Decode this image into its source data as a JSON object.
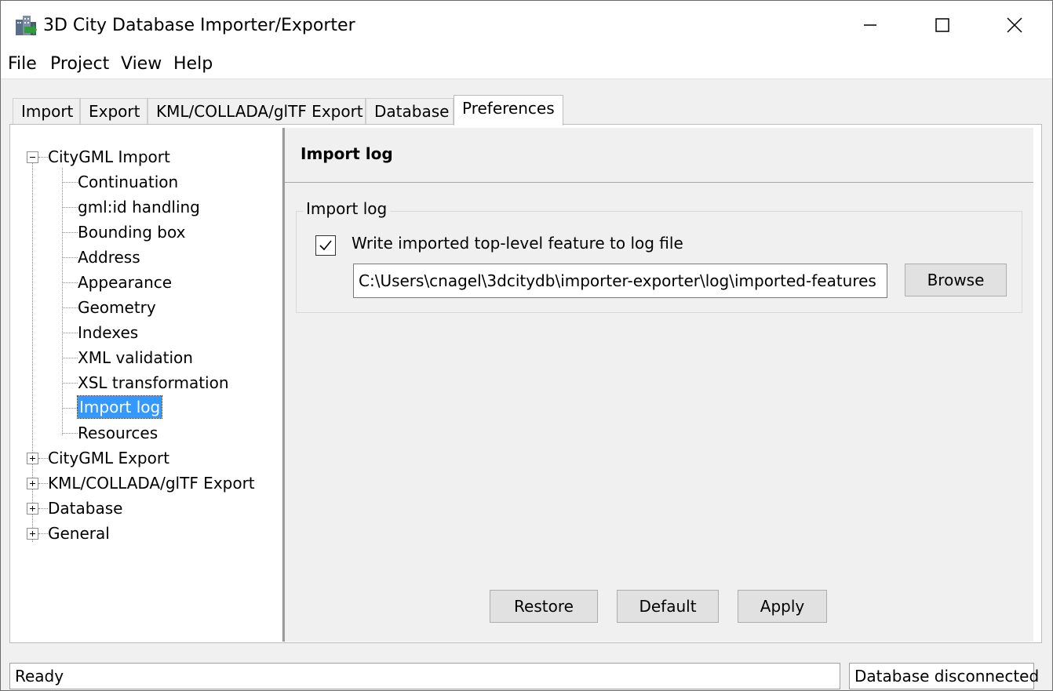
{
  "window": {
    "title": "3D City Database Importer/Exporter",
    "controls": {
      "minimize": "–",
      "maximize": "□",
      "close": "✕"
    }
  },
  "menu": {
    "items": [
      "File",
      "Project",
      "View",
      "Help"
    ]
  },
  "tabs": [
    {
      "label": "Import"
    },
    {
      "label": "Export"
    },
    {
      "label": "KML/COLLADA/glTF Export"
    },
    {
      "label": "Database"
    },
    {
      "label": "Preferences"
    }
  ],
  "active_tab": "Preferences",
  "tree": {
    "citygml_import": {
      "label": "CityGML Import",
      "expanded": true,
      "children": [
        "Continuation",
        "gml:id handling",
        "Bounding box",
        "Address",
        "Appearance",
        "Geometry",
        "Indexes",
        "XML validation",
        "XSL transformation",
        "Import log",
        "Resources"
      ]
    },
    "collapsed_roots": [
      "CityGML Export",
      "KML/COLLADA/glTF Export",
      "Database",
      "General"
    ],
    "selected": "Import log"
  },
  "panel": {
    "title": "Import log",
    "group": {
      "label": "Import log",
      "checkbox_label": "Write imported top-level feature to log file",
      "checkbox_checked": true,
      "path_value": "C:\\Users\\cnagel\\3dcitydb\\importer-exporter\\log\\imported-features",
      "browse_label": "Browse"
    },
    "buttons": {
      "restore": "Restore",
      "default": "Default",
      "apply": "Apply"
    }
  },
  "status": {
    "left": "Ready",
    "right": "Database disconnected"
  },
  "colors": {
    "selection": "#3399ff",
    "window_bg": "#f0f0f0"
  }
}
